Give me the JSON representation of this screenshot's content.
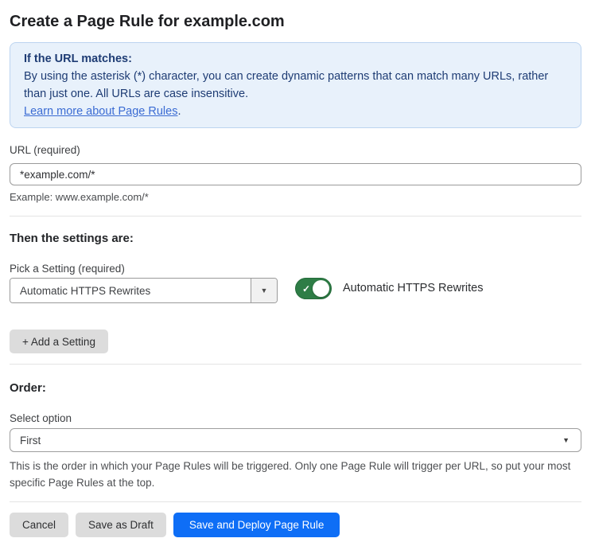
{
  "page": {
    "title": "Create a Page Rule for example.com"
  },
  "info_banner": {
    "heading": "If the URL matches:",
    "body": "By using the asterisk (*) character, you can create dynamic patterns that can match many URLs, rather than just one. All URLs are case insensitive.",
    "link_label": "Learn more about Page Rules",
    "link_suffix": "."
  },
  "url_field": {
    "label": "URL (required)",
    "value": "*example.com/*",
    "helper": "Example: www.example.com/*"
  },
  "settings_section": {
    "heading": "Then the settings are:",
    "picker_label": "Pick a Setting (required)",
    "picker_value": "Automatic HTTPS Rewrites",
    "toggle_label": "Automatic HTTPS Rewrites",
    "toggle_state": "on",
    "add_setting_label": "+ Add a Setting"
  },
  "order_section": {
    "heading": "Order:",
    "select_label": "Select option",
    "select_value": "First",
    "helper": "This is the order in which your Page Rules will be triggered. Only one Page Rule will trigger per URL, so put your most specific Page Rules at the top."
  },
  "footer": {
    "cancel_label": "Cancel",
    "save_draft_label": "Save as Draft",
    "save_deploy_label": "Save and Deploy Page Rule"
  },
  "icons": {
    "dropdown_arrow": "▼",
    "checkmark": "✓"
  },
  "colors": {
    "banner_bg": "#e8f1fb",
    "banner_border": "#bcd4f0",
    "banner_text": "#1e3c74",
    "link": "#3a6bd3",
    "toggle_on": "#2e7d46",
    "primary_button": "#0e6ef6",
    "secondary_button": "#dcdcdc"
  }
}
